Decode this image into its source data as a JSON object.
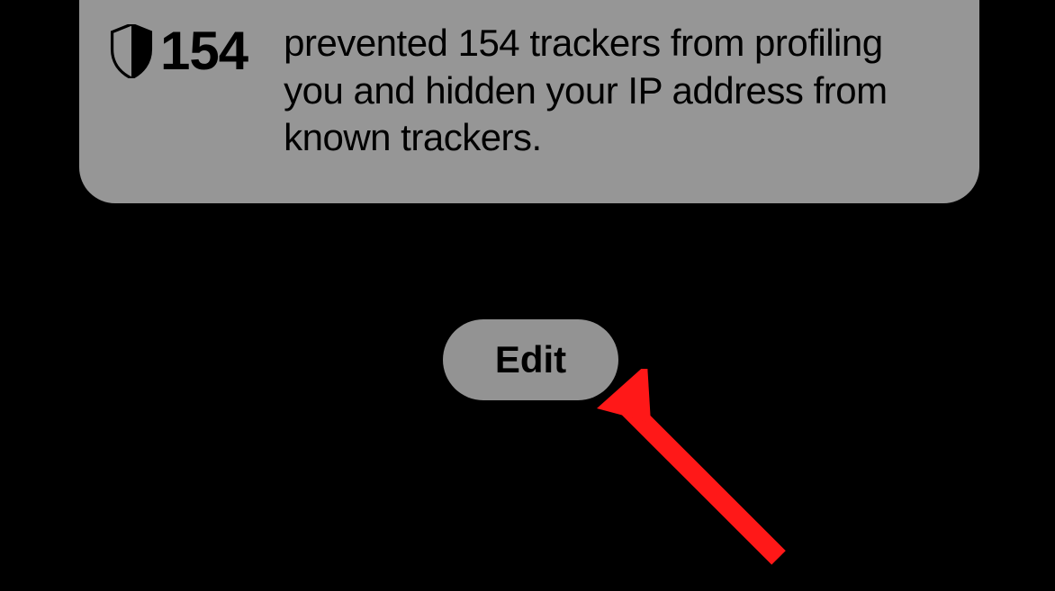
{
  "privacy": {
    "tracker_count": "154",
    "description": "prevented 154 trackers from profiling you and hidden your IP address from known trackers."
  },
  "buttons": {
    "edit_label": "Edit"
  },
  "colors": {
    "card_bg": "#969696",
    "page_bg": "#000000",
    "arrow": "#FF0000"
  }
}
